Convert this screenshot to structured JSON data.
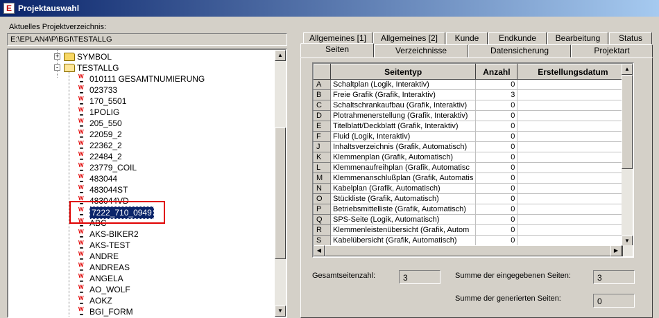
{
  "window": {
    "title": "Projektauswahl",
    "app_icon": "eplan-app-icon"
  },
  "path": {
    "label": "Aktuelles Projektverzeichnis:",
    "value": "E:\\EPLAN4\\P\\BGI\\TESTALLG"
  },
  "tree": {
    "folders": [
      {
        "label": "SYMBOL",
        "expander": "+"
      },
      {
        "label": "TESTALLG",
        "expander": "-"
      }
    ],
    "items": [
      "010111 GESAMTNUMIERUNG",
      "023733",
      "170_5501",
      "1POLIG",
      "205_550",
      "22059_2",
      "22362_2",
      "22484_2",
      "23779_COIL",
      "483044",
      "483044ST",
      "483044VD",
      "7222_710_0949",
      "ABC",
      "AKS-BIKER2",
      "AKS-TEST",
      "ANDRE",
      "ANDREAS",
      "ANGELA",
      "AO_WOLF",
      "AOKZ",
      "BGI_FORM"
    ],
    "selected": "7222_710_0949"
  },
  "tabs": {
    "row1": [
      "Allgemeines [1]",
      "Allgemeines [2]",
      "Kunde",
      "Endkunde",
      "Bearbeitung",
      "Status"
    ],
    "row2": [
      "Seiten",
      "Verzeichnisse",
      "Datensicherung",
      "Projektart"
    ],
    "active": "Seiten"
  },
  "grid": {
    "headers": [
      "",
      "Seitentyp",
      "Anzahl",
      "Erstellungsdatum"
    ],
    "rows": [
      [
        "A",
        "Schaltplan  (Logik, Interaktiv)",
        "0",
        ""
      ],
      [
        "B",
        "Freie Grafik  (Grafik, Interaktiv)",
        "3",
        ""
      ],
      [
        "C",
        "Schaltschrankaufbau  (Grafik, Interaktiv)",
        "0",
        ""
      ],
      [
        "D",
        "Plotrahmenerstellung  (Grafik, Interaktiv)",
        "0",
        ""
      ],
      [
        "E",
        "Titelblatt/Deckblatt  (Grafik, Interaktiv)",
        "0",
        ""
      ],
      [
        "F",
        "Fluid  (Logik, Interaktiv)",
        "0",
        ""
      ],
      [
        "J",
        "Inhaltsverzeichnis  (Grafik, Automatisch)",
        "0",
        ""
      ],
      [
        "K",
        "Klemmenplan  (Grafik, Automatisch)",
        "0",
        ""
      ],
      [
        "L",
        "Klemmenaufreihplan  (Grafik, Automatisc",
        "0",
        ""
      ],
      [
        "M",
        "Klemmenanschlußplan  (Grafik, Automatis",
        "0",
        ""
      ],
      [
        "N",
        "Kabelplan  (Grafik, Automatisch)",
        "0",
        ""
      ],
      [
        "O",
        "Stückliste  (Grafik, Automatisch)",
        "0",
        ""
      ],
      [
        "P",
        "Betriebsmittelliste  (Grafik, Automatisch)",
        "0",
        ""
      ],
      [
        "Q",
        "SPS-Seite  (Logik, Automatisch)",
        "0",
        ""
      ],
      [
        "R",
        "Klemmenleistenübersicht  (Grafik, Autom",
        "0",
        ""
      ],
      [
        "S",
        "Kabelübersicht  (Grafik, Automatisch)",
        "0",
        ""
      ]
    ]
  },
  "stats": {
    "total_label": "Gesamtseitenzahl:",
    "total_value": "3",
    "entered_label": "Summe der eingegebenen Seiten:",
    "entered_value": "3",
    "generated_label": "Summe der generierten Seiten:",
    "generated_value": "0"
  }
}
